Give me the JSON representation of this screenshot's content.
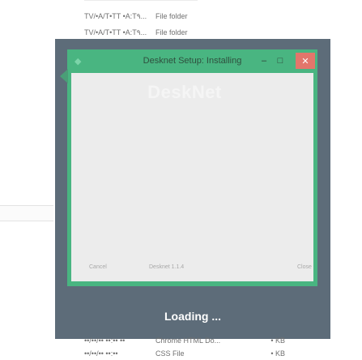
{
  "explorer": {
    "rows_top": [
      {
        "date": "TV/•A/T•TT •A:T٩...",
        "type": "File folder"
      },
      {
        "date": "TV/•A/T•TT •A:T٩...",
        "type": "File folder"
      }
    ],
    "rows_bottom": [
      {
        "date": "••/••/•• ••:•• ••",
        "type": "Chrome HTML Do...",
        "size": "• KB"
      },
      {
        "date": "••/••/•• ••:••",
        "type": "CSS File",
        "size": "• KB"
      }
    ]
  },
  "setup": {
    "title": "Desknet Setup: Installing",
    "logo_glyph": "◆",
    "minimize_glyph": "–",
    "maximize_glyph": "□",
    "close_glyph": "✕",
    "brand": "DeskNet",
    "cancel_label": "Cancel",
    "version": "Desknet 1.1.4",
    "close_label": "Close"
  },
  "loader": {
    "text": "Loading ..."
  },
  "colors": {
    "window_green": "#49b581",
    "overlay": "#5d6c79",
    "close_red": "#e3766b"
  },
  "icons": [
    "back-arrow-icon",
    "app-logo-icon",
    "minimize-icon",
    "maximize-icon",
    "close-icon"
  ]
}
